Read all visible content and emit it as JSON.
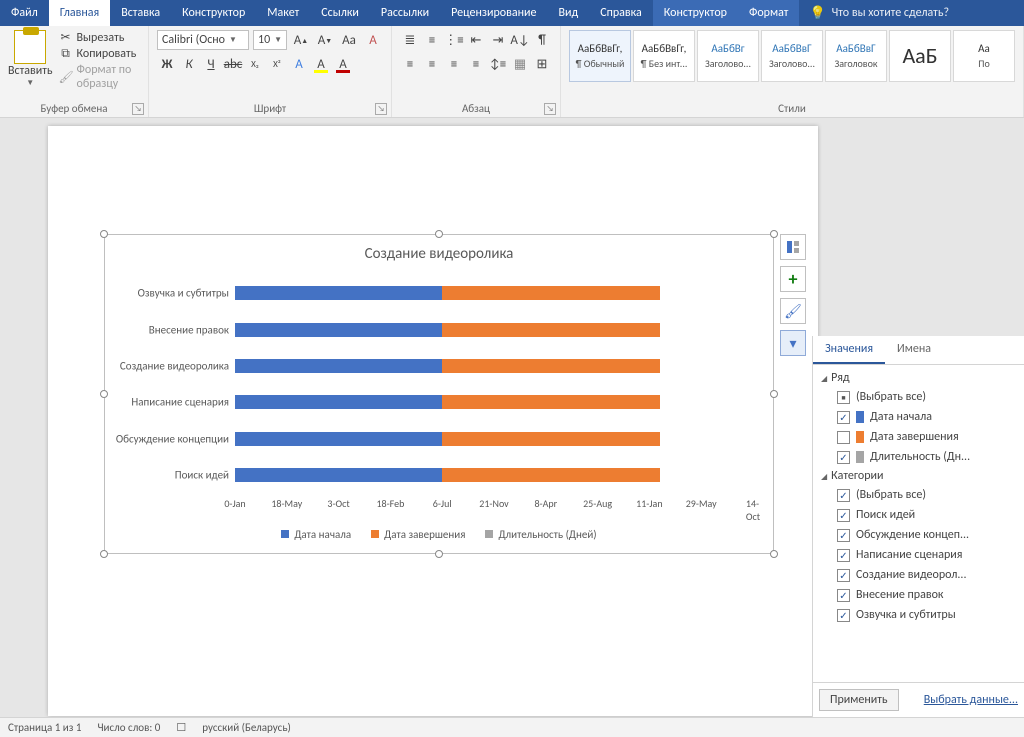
{
  "tabs": {
    "file": "Файл",
    "home": "Главная",
    "insert": "Вставка",
    "design": "Конструктор",
    "layout": "Макет",
    "references": "Ссылки",
    "mailings": "Рассылки",
    "review": "Рецензирование",
    "view": "Вид",
    "help": "Справка",
    "chart_design": "Конструктор",
    "chart_format": "Формат",
    "tell_me": "Что вы хотите сделать?"
  },
  "ribbon": {
    "clipboard": {
      "label": "Буфер обмена",
      "paste": "Вставить",
      "cut": "Вырезать",
      "copy": "Копировать",
      "format_painter": "Формат по образцу"
    },
    "font": {
      "label": "Шрифт",
      "name": "Calibri (Осно",
      "size": "10"
    },
    "paragraph": {
      "label": "Абзац"
    },
    "styles": {
      "label": "Стили",
      "items": [
        {
          "preview": "АаБбВвГг,",
          "name": "¶ Обычный",
          "cls": ""
        },
        {
          "preview": "АаБбВвГг,",
          "name": "¶ Без инт...",
          "cls": ""
        },
        {
          "preview": "АаБбВг",
          "name": "Заголово...",
          "cls": "blue"
        },
        {
          "preview": "АаБбВвГ",
          "name": "Заголово...",
          "cls": "blue"
        },
        {
          "preview": "АаБбВвГ",
          "name": "Заголовок",
          "cls": "blue"
        },
        {
          "preview": "АаБ",
          "name": "",
          "cls": "big"
        },
        {
          "preview": "Аа",
          "name": "По",
          "cls": ""
        }
      ]
    }
  },
  "chart_data": {
    "type": "bar",
    "title": "Создание видеоролика",
    "categories": [
      "Озвучка и субтитры",
      "Внесение правок",
      "Создание видеоролика",
      "Написание сценария",
      "Обсуждение концепции",
      "Поиск идей"
    ],
    "x_ticks": [
      "0-Jan",
      "18-May",
      "3-Oct",
      "18-Feb",
      "6-Jul",
      "21-Nov",
      "8-Apr",
      "25-Aug",
      "11-Jan",
      "29-May",
      "14-Oct"
    ],
    "series": [
      {
        "name": "Дата начала",
        "color": "#4472c4",
        "values": [
          40,
          40,
          40,
          40,
          40,
          40
        ]
      },
      {
        "name": "Дата завершения",
        "color": "#ed7d31",
        "values": [
          42,
          42,
          42,
          42,
          42,
          42
        ]
      },
      {
        "name": "Длительность (Дней)",
        "color": "#a5a5a5",
        "values": [
          0,
          0,
          0,
          0,
          0,
          0
        ]
      }
    ],
    "legend": [
      "Дата начала",
      "Дата завершения",
      "Длительность (Дней)"
    ]
  },
  "chart_buttons": {
    "layout": "layout-options",
    "add_element": "add-element",
    "style": "chart-style",
    "filter": "chart-filter"
  },
  "filter_pane": {
    "tab_values": "Значения",
    "tab_names": "Имена",
    "section_series": "Ряд",
    "section_categories": "Категории",
    "select_all": "(Выбрать все)",
    "series": [
      {
        "label": "Дата начала",
        "checked": true,
        "color": "#4472c4"
      },
      {
        "label": "Дата завершения",
        "checked": false,
        "color": "#ed7d31"
      },
      {
        "label": "Длительность (Дн...",
        "checked": true,
        "color": "#a5a5a5"
      }
    ],
    "categories": [
      {
        "label": "Поиск идей",
        "checked": true
      },
      {
        "label": "Обсуждение концеп...",
        "checked": true
      },
      {
        "label": "Написание сценария",
        "checked": true
      },
      {
        "label": "Создание видеорол...",
        "checked": true
      },
      {
        "label": "Внесение правок",
        "checked": true
      },
      {
        "label": "Озвучка и субтитры",
        "checked": true
      }
    ],
    "apply": "Применить",
    "select_data": "Выбрать данные..."
  },
  "status": {
    "page": "Страница 1 из 1",
    "words": "Число слов: 0",
    "lang": "русский (Беларусь)"
  }
}
